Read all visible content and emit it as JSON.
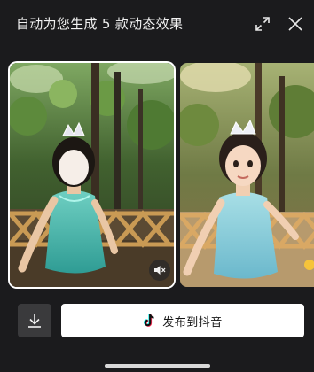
{
  "header": {
    "title": "自动为您生成 5 款动态效果",
    "expand_icon": "expand-arrows-icon",
    "close_icon": "close-icon"
  },
  "carousel": {
    "items": [
      {
        "label": "original-photo",
        "selected": true
      },
      {
        "label": "cartoon-effect",
        "selected": false
      }
    ],
    "mute_icon": "speaker-muted-icon"
  },
  "actions": {
    "download_icon": "download-icon",
    "publish_label": "发布到抖音",
    "publish_icon": "douyin-logo-icon"
  },
  "colors": {
    "background": "#1b1b1d",
    "publish_button": "#ffffff",
    "download_button": "#3a3a3c",
    "douyin_cyan": "#25f4ee",
    "douyin_red": "#fe2c55"
  }
}
